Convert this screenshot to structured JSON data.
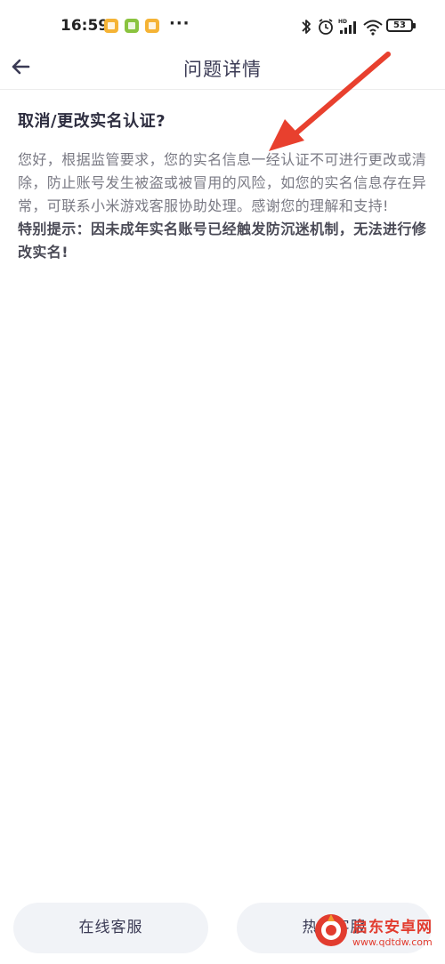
{
  "status_bar": {
    "time": "16:59",
    "more": "···",
    "battery": "53",
    "notification_icons": [
      "app-notification-icon",
      "download-notification-icon",
      "app-notification-icon"
    ],
    "right_icons": [
      "bluetooth-icon",
      "alarm-icon",
      "hd-signal-icon",
      "wifi-icon",
      "battery-icon"
    ]
  },
  "header": {
    "title": "问题详情",
    "back_icon": "back-arrow-icon"
  },
  "content": {
    "question": "取消/更改实名认证?",
    "answer_line1": "您好，根据监管要求，您的实名信息一经认证不可进行更改或清除，防止账号发生被盗或被冒用的风险，如您的实名信息存在异常，可联系小米游戏客服协助处理。感谢您的理解和支持!",
    "answer_line2": "特别提示：因未成年实名账号已经触发防沉迷机制，无法进行修改实名!"
  },
  "footer": {
    "online_service": "在线客服",
    "hotline_service": "热线客服"
  },
  "watermark": {
    "name": "启东安卓网",
    "url": "www.qdtdw.com"
  },
  "colors": {
    "title_text": "#3b3b55",
    "body_text": "#7a7a84",
    "button_bg": "#f1f3f7",
    "annotation_arrow": "#e8402e"
  }
}
